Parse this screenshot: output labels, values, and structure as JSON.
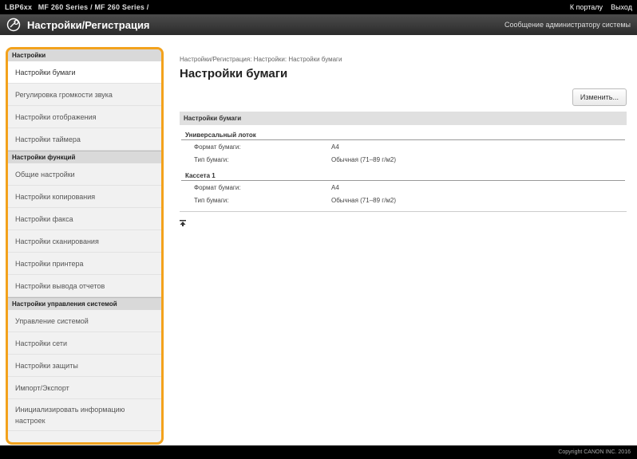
{
  "topbar": {
    "device_model": "LBP6xx",
    "device_series": "MF 260 Series / MF 260 Series /",
    "portal_link": "К порталу",
    "logout_link": "Выход"
  },
  "header": {
    "title": "Настройки/Регистрация",
    "admin_link": "Сообщение администратору системы"
  },
  "sidebar": {
    "sections": [
      {
        "title": "Настройки",
        "items": [
          "Настройки бумаги",
          "Регулировка громкости звука",
          "Настройки отображения",
          "Настройки таймера"
        ]
      },
      {
        "title": "Настройки функций",
        "items": [
          "Общие настройки",
          "Настройки копирования",
          "Настройки факса",
          "Настройки сканирования",
          "Настройки принтера",
          "Настройки вывода отчетов"
        ]
      },
      {
        "title": "Настройки управления системой",
        "items": [
          "Управление системой",
          "Настройки сети",
          "Настройки защиты",
          "Импорт/Экспорт",
          "Инициализировать информацию настроек"
        ]
      }
    ]
  },
  "main": {
    "breadcrumb": "Настройки/Регистрация: Настройки: Настройки бумаги",
    "title": "Настройки бумаги",
    "edit_button": "Изменить...",
    "section_title": "Настройки бумаги",
    "groups": [
      {
        "title": "Универсальный лоток",
        "rows": [
          {
            "label": "Формат бумаги:",
            "value": "A4"
          },
          {
            "label": "Тип бумаги:",
            "value": "Обычная (71–89 г/м2)"
          }
        ]
      },
      {
        "title": "Кассета 1",
        "rows": [
          {
            "label": "Формат бумаги:",
            "value": "A4"
          },
          {
            "label": "Тип бумаги:",
            "value": "Обычная (71–89 г/м2)"
          }
        ]
      }
    ]
  },
  "footer": {
    "copyright": "Copyright CANON INC. 2016"
  }
}
